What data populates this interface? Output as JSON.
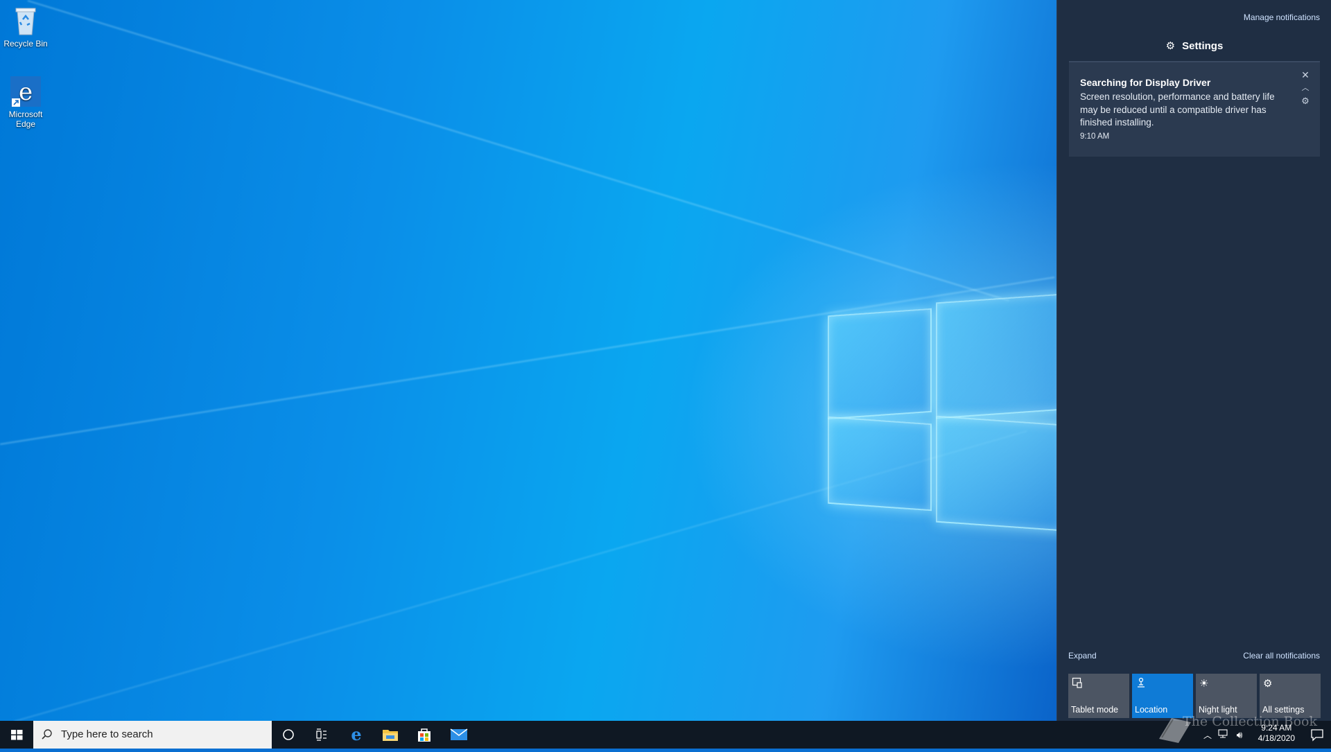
{
  "desktop": {
    "icons": [
      {
        "label": "Recycle Bin",
        "icon": "recycle-bin-icon"
      },
      {
        "label": "Microsoft Edge",
        "icon": "edge-icon"
      }
    ]
  },
  "action_center": {
    "manage_notifications": "Manage notifications",
    "group_header": "Settings",
    "notification": {
      "title": "Searching for Display Driver",
      "body": "Screen resolution, performance and battery life may be reduced until a compatible driver has finished installing.",
      "time": "9:10 AM"
    },
    "expand_label": "Expand",
    "clear_all_label": "Clear all notifications",
    "quick_actions": [
      {
        "label": "Tablet mode",
        "icon": "tablet-mode-icon",
        "active": false
      },
      {
        "label": "Location",
        "icon": "location-icon",
        "active": true
      },
      {
        "label": "Night light",
        "icon": "night-light-icon",
        "active": false
      },
      {
        "label": "All settings",
        "icon": "gear-icon",
        "active": false
      }
    ]
  },
  "taskbar": {
    "search_placeholder": "Type here to search",
    "clock_time": "9:24 AM",
    "clock_date": "4/18/2020",
    "pinned": [
      "cortana-icon",
      "task-view-icon",
      "edge-icon",
      "file-explorer-icon",
      "store-icon",
      "mail-icon"
    ]
  },
  "watermark": "The Collection Book",
  "colors": {
    "accent": "#0f7bd6",
    "action_center_bg": "#1f2e43",
    "taskbar_bg": "#0f1823"
  }
}
